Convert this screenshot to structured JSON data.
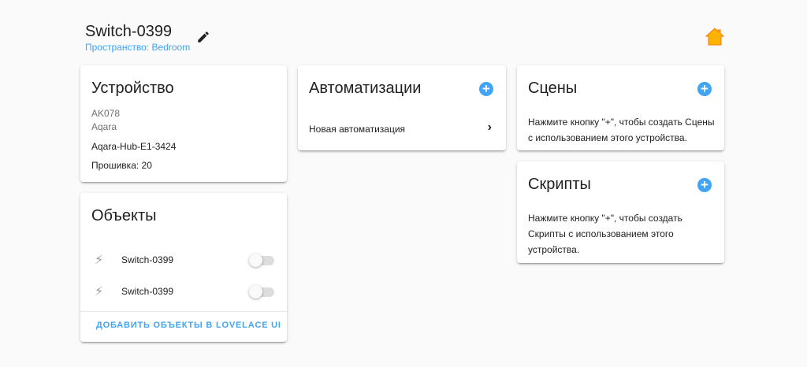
{
  "header": {
    "title": "Switch-0399",
    "area": "Пространство: Bedroom"
  },
  "device": {
    "title": "Устройство",
    "model": "AK078",
    "manufacturer": "Aqara",
    "via": "Aqara-Hub-E1-3424",
    "firmware": "Прошивка: 20"
  },
  "entities": {
    "title": "Объекты",
    "items": [
      {
        "name": "Switch-0399",
        "state": "off"
      },
      {
        "name": "Switch-0399",
        "state": "off"
      }
    ],
    "add_button": "ДОБАВИТЬ ОБЪЕКТЫ В LOVELACE UI"
  },
  "automations": {
    "title": "Автоматизации",
    "items": [
      "Новая автоматизация"
    ]
  },
  "scenes": {
    "title": "Сцены",
    "hint": "Нажмите кнопку \"+\", чтобы создать Сцены с использованием этого устройства."
  },
  "scripts": {
    "title": "Скрипты",
    "hint": "Нажмите кнопку \"+\", чтобы создать Скрипты с использованием этого устройства."
  },
  "colors": {
    "accent": "#41a4f4",
    "home": "#ffa000"
  }
}
